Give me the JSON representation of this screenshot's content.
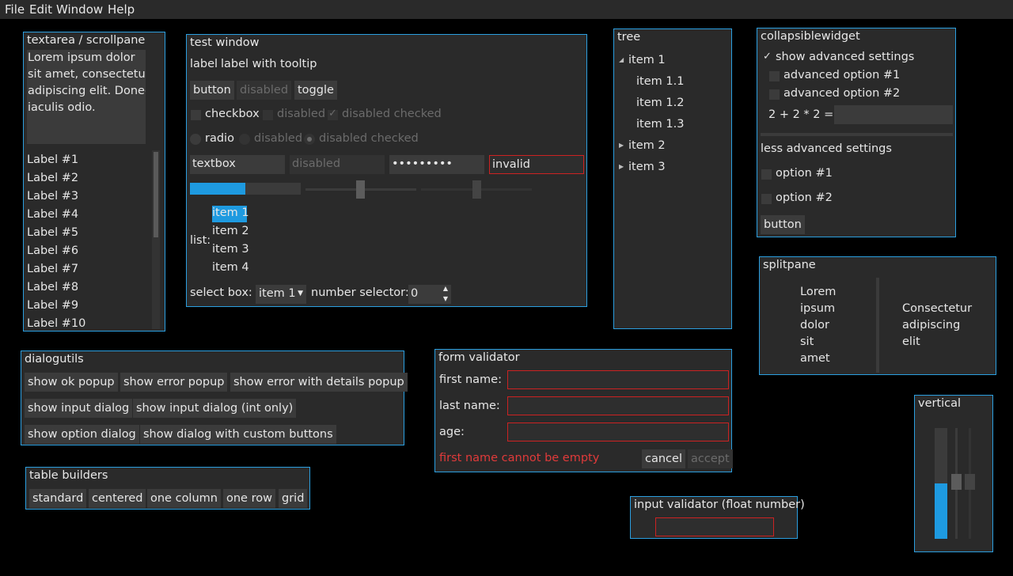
{
  "menubar": [
    "File",
    "Edit",
    "Window",
    "Help"
  ],
  "textarea": {
    "title": "textarea / scrollpane",
    "lines": [
      "Lorem ipsum dolor",
      "sit amet, consectetur",
      "adipiscing elit. Donec",
      "iaculis odio."
    ],
    "labels": [
      "Label #1",
      "Label #2",
      "Label #3",
      "Label #4",
      "Label #5",
      "Label #6",
      "Label #7",
      "Label #8",
      "Label #9",
      "Label #10"
    ]
  },
  "test": {
    "title": "test window",
    "label": "label",
    "tooltip_label": "label with tooltip",
    "button": "button",
    "disabled": "disabled",
    "toggle": "toggle",
    "checkbox": "checkbox",
    "disabled_checked": "disabled checked",
    "radio": "radio",
    "textbox": "textbox",
    "password": "•••••••••",
    "invalid": "invalid",
    "progress": 0.5,
    "slider1": 0.49,
    "slider2": 0.5,
    "list_label": "list:",
    "list_items": [
      "item 1",
      "item 2",
      "item 3",
      "item 4"
    ],
    "select_label": "select box:",
    "select_value": "item 1",
    "number_label": "number selector:",
    "number_value": "0"
  },
  "tree": {
    "title": "tree",
    "item1": "item 1",
    "children": [
      "item 1.1",
      "item 1.2",
      "item 1.3"
    ],
    "item2": "item 2",
    "item3": "item 3"
  },
  "collapsible": {
    "title": "collapsiblewidget",
    "show_advanced": "show advanced settings",
    "adv1": "advanced option #1",
    "adv2": "advanced option #2",
    "expr": "2 + 2 * 2 =",
    "less": "less advanced settings",
    "opt1": "option #1",
    "opt2": "option #2",
    "button": "button"
  },
  "splitpane": {
    "title": "splitpane",
    "left": [
      "Lorem",
      "ipsum",
      "dolor",
      "sit",
      "amet"
    ],
    "right": [
      "Consectetur",
      "adipiscing",
      "elit"
    ]
  },
  "dialogutils": {
    "title": "dialogutils",
    "buttons": [
      "show ok popup",
      "show error popup",
      "show error with details popup",
      "show input dialog",
      "show input dialog (int only)",
      "show option dialog",
      "show dialog with custom buttons"
    ]
  },
  "formval": {
    "title": "form validator",
    "first": "first name:",
    "last": "last name:",
    "age": "age:",
    "error": "first name cannot be empty",
    "cancel": "cancel",
    "accept": "accept"
  },
  "table": {
    "title": "table builders",
    "buttons": [
      "standard",
      "centered",
      "one column",
      "one row",
      "grid"
    ]
  },
  "inputval": {
    "title": "input validator (float number)"
  },
  "vertical": {
    "title": "vertical",
    "progress": 0.5
  },
  "colors": {
    "accent": "#1e9ae0",
    "border": "#2b9fe0",
    "error": "#cc2222",
    "panel": "#2a2a2a"
  }
}
